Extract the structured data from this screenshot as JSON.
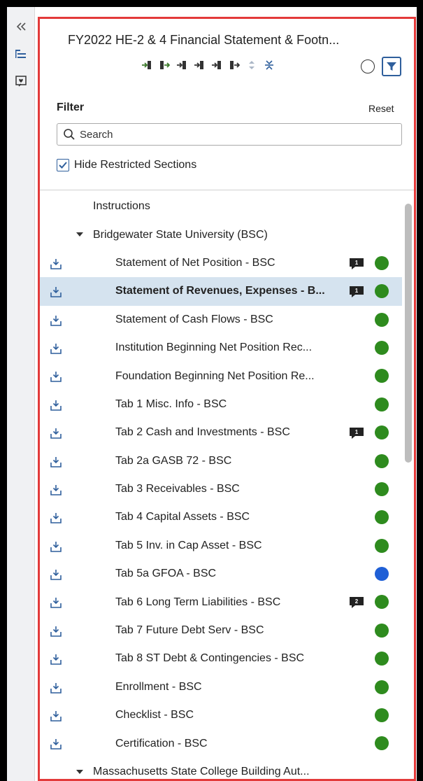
{
  "header": {
    "title": "FY2022 HE-2 & 4 Financial Statement & Footn...",
    "filter_label": "Filter",
    "reset_label": "Reset"
  },
  "search": {
    "placeholder": "Search",
    "value": ""
  },
  "hide_restricted": {
    "label": "Hide Restricted Sections",
    "checked": true
  },
  "colors": {
    "accent": "#2f5f9c",
    "status_green": "#2e8b1e",
    "status_blue": "#1f5fd6",
    "selection": "#d5e3ef",
    "panel_border": "#e33a3a"
  },
  "tree": {
    "items": [
      {
        "label": "Instructions",
        "level": 0,
        "download": false
      },
      {
        "label": "Bridgewater State University (BSC)",
        "level": 1,
        "expandable": true
      },
      {
        "label": "Statement of Net Position - BSC",
        "level": 2,
        "download": true,
        "comments": "1",
        "status": "green"
      },
      {
        "label": "Statement of Revenues, Expenses - B...",
        "level": 2,
        "download": true,
        "comments": "1",
        "status": "green",
        "selected": true
      },
      {
        "label": "Statement of Cash Flows - BSC",
        "level": 2,
        "download": true,
        "status": "green"
      },
      {
        "label": "Institution Beginning Net Position Rec...",
        "level": 2,
        "download": true,
        "status": "green"
      },
      {
        "label": "Foundation Beginning Net Position Re...",
        "level": 2,
        "download": true,
        "status": "green"
      },
      {
        "label": "Tab 1 Misc. Info - BSC",
        "level": 2,
        "download": true,
        "status": "green"
      },
      {
        "label": "Tab 2 Cash and Investments - BSC",
        "level": 2,
        "download": true,
        "comments": "1",
        "status": "green"
      },
      {
        "label": "Tab 2a GASB 72 - BSC",
        "level": 2,
        "download": true,
        "status": "green"
      },
      {
        "label": "Tab 3 Receivables - BSC",
        "level": 2,
        "download": true,
        "status": "green"
      },
      {
        "label": "Tab 4 Capital Assets - BSC",
        "level": 2,
        "download": true,
        "status": "green"
      },
      {
        "label": "Tab 5 Inv. in Cap Asset - BSC",
        "level": 2,
        "download": true,
        "status": "green"
      },
      {
        "label": "Tab 5a GFOA - BSC",
        "level": 2,
        "download": true,
        "status": "blue"
      },
      {
        "label": "Tab 6 Long Term Liabilities - BSC",
        "level": 2,
        "download": true,
        "comments": "2",
        "status": "green"
      },
      {
        "label": "Tab 7 Future Debt Serv - BSC",
        "level": 2,
        "download": true,
        "status": "green"
      },
      {
        "label": "Tab 8 ST Debt & Contingencies - BSC",
        "level": 2,
        "download": true,
        "status": "green"
      },
      {
        "label": "Enrollment - BSC",
        "level": 2,
        "download": true,
        "status": "green"
      },
      {
        "label": "Checklist - BSC",
        "level": 2,
        "download": true,
        "status": "green"
      },
      {
        "label": "Certification - BSC",
        "level": 2,
        "download": true,
        "status": "green"
      },
      {
        "label": "Massachusetts State College Building Aut...",
        "level": 1,
        "expandable": true
      }
    ]
  }
}
